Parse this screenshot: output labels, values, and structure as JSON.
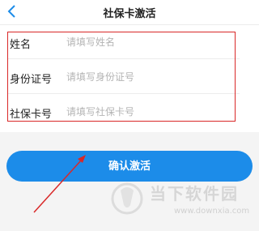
{
  "header": {
    "title": "社保卡激活",
    "back_icon": "chevron-left-icon"
  },
  "form": {
    "fields": [
      {
        "label": "姓名",
        "placeholder": "请填写姓名",
        "value": ""
      },
      {
        "label": "身份证号",
        "placeholder": "请填写身份证号",
        "value": ""
      },
      {
        "label": "社保卡号",
        "placeholder": "请填写社保卡号",
        "value": ""
      }
    ]
  },
  "confirm_button": {
    "label": "确认激活"
  },
  "watermark": {
    "text": "当下软件园",
    "url": "www.downxia.com"
  },
  "colors": {
    "accent": "#1c8ce9",
    "annotation": "#d92828"
  }
}
